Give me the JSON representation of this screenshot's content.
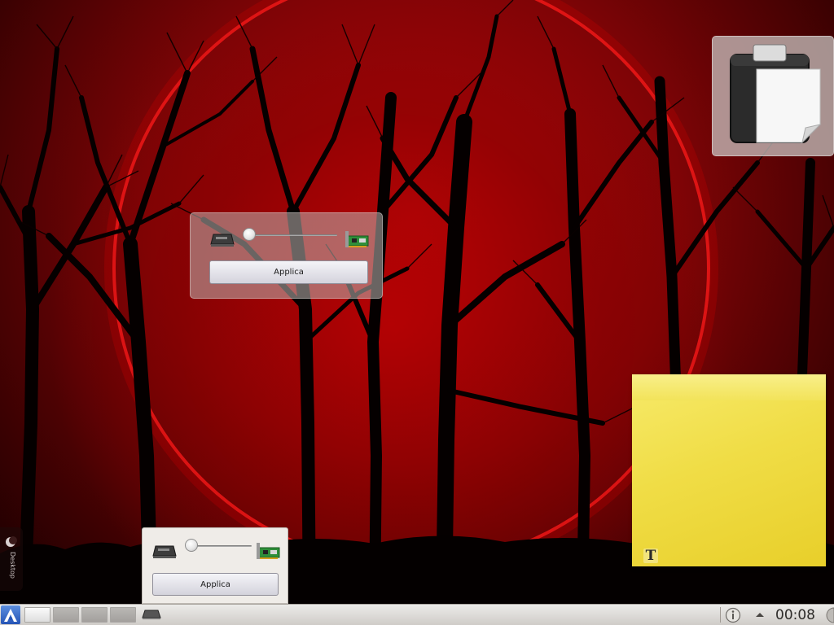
{
  "desktop": {
    "toolbox_label": "Desktop"
  },
  "slider_widget_floating": {
    "value": 0,
    "apply_label": "Applica"
  },
  "slider_widget_panel": {
    "value": 0,
    "apply_label": "Applica"
  },
  "taskbar": {
    "launcher_icon": "kde-launcher-icon",
    "virtual_desktops": [
      {
        "active": true
      },
      {
        "active": false
      },
      {
        "active": false
      },
      {
        "active": false
      }
    ],
    "tray_icons": [
      "notifications-icon",
      "show-hidden-icons-arrow",
      "dashboard-half-circle-icon"
    ],
    "clock": "00:08"
  },
  "colors": {
    "wallpaper_red": "#9a0508",
    "note_yellow": "#f0dd46",
    "taskbar": "#dcdad6"
  }
}
